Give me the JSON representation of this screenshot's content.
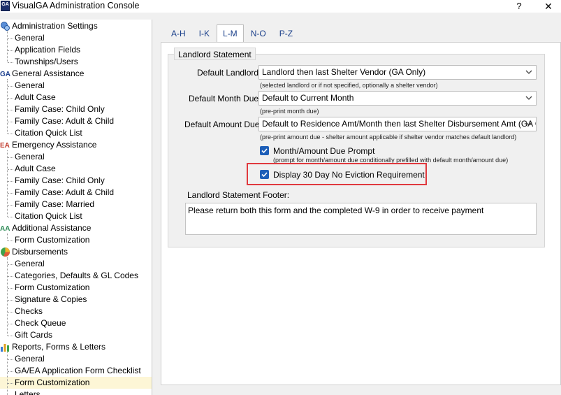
{
  "window": {
    "title": "VisualGA Administration Console",
    "app_icon_text": "GA",
    "help_glyph": "?",
    "close_glyph": "✕"
  },
  "tree": {
    "groups": [
      {
        "label": "Administration Settings",
        "icon": "admin-settings-icon",
        "children": [
          "General",
          "Application Fields",
          "Townships/Users"
        ]
      },
      {
        "label": "General Assistance",
        "icon": "general-assistance-icon",
        "children": [
          "General",
          "Adult Case",
          "Family Case: Child Only",
          "Family Case: Adult & Child",
          "Citation Quick List"
        ]
      },
      {
        "label": "Emergency Assistance",
        "icon": "emergency-assistance-icon",
        "children": [
          "General",
          "Adult Case",
          "Family Case: Child Only",
          "Family Case: Adult & Child",
          "Family Case: Married",
          "Citation Quick List"
        ]
      },
      {
        "label": "Additional Assistance",
        "icon": "additional-assistance-icon",
        "children": [
          "Form Customization"
        ]
      },
      {
        "label": "Disbursements",
        "icon": "pie-chart-icon",
        "children": [
          "General",
          "Categories, Defaults & GL Codes",
          "Form Customization",
          "Signature & Copies",
          "Checks",
          "Check Queue",
          "Gift Cards"
        ]
      },
      {
        "label": "Reports, Forms & Letters",
        "icon": "bar-chart-icon",
        "children": [
          "General",
          "GA/EA Application Form Checklist",
          "Form Customization",
          "Letters"
        ]
      }
    ],
    "selected": "Reports, Forms & Letters / Form Customization"
  },
  "tabs": [
    "A-H",
    "I-K",
    "L-M",
    "N-O",
    "P-Z"
  ],
  "active_tab": "L-M",
  "landlord": {
    "group_title": "Landlord Statement",
    "default_landlord_label": "Default Landlord:",
    "default_landlord_value": "Landlord then last Shelter Vendor (GA Only)",
    "default_landlord_hint": "(selected landlord or if not specified, optionally a shelter vendor)",
    "default_month_label": "Default Month Due:",
    "default_month_value": "Default to Current Month",
    "default_month_hint": "(pre-print month due)",
    "default_amount_label": "Default Amount Due:",
    "default_amount_value": "Default to Residence Amt/Month then last Shelter Disbursement Amt (GA Only)",
    "default_amount_hint": "(pre-print amount due - shelter amount applicable if shelter vendor matches default landlord)",
    "month_prompt_label": "Month/Amount Due Prompt",
    "month_prompt_checked": true,
    "month_prompt_hint": "(prompt for month/amount due conditionally prefilled with default month/amount due)",
    "eviction_label": "Display 30 Day No Eviction Requirement",
    "eviction_checked": true,
    "footer_label": "Landlord Statement Footer:",
    "footer_text": "Please return both this form and the completed W-9 in order to receive payment"
  },
  "colors": {
    "tab_text": "#1a3f8a",
    "checkbox": "#1e5fb8",
    "highlight": "#e0393e",
    "selected_row": "#fdf6d6"
  }
}
